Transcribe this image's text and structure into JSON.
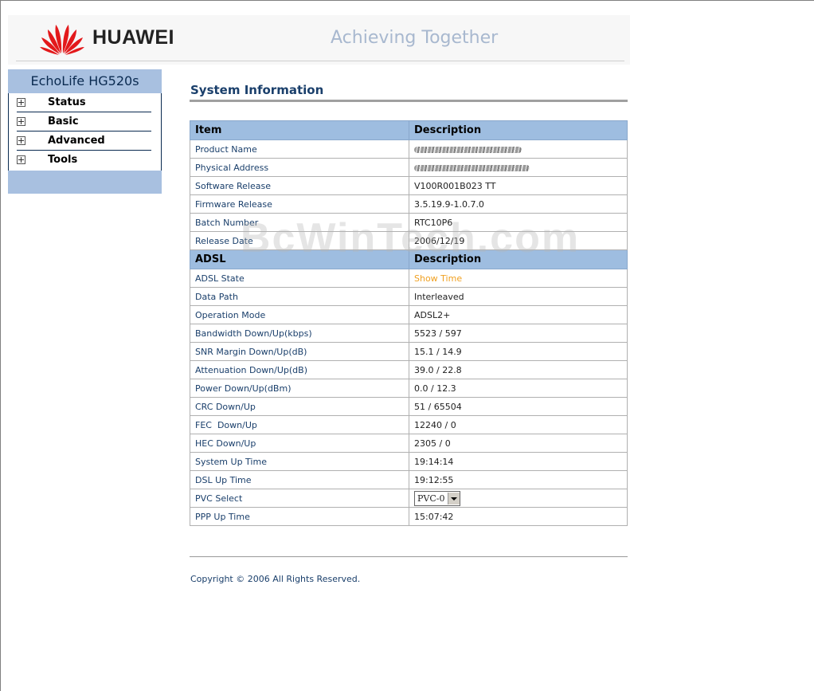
{
  "header": {
    "brand": "HUAWEI",
    "slogan": "Achieving Together",
    "logo_color": "#e3191b"
  },
  "sidebar": {
    "model": "EchoLife HG520s",
    "items": [
      {
        "label": "Status"
      },
      {
        "label": "Basic"
      },
      {
        "label": "Advanced"
      },
      {
        "label": "Tools"
      }
    ]
  },
  "main": {
    "title": "System Information",
    "section1": {
      "col1": "Item",
      "col2": "Description"
    },
    "rows1": [
      {
        "item": "Product Name",
        "desc": ""
      },
      {
        "item": "Physical Address",
        "desc": ""
      },
      {
        "item": "Software Release",
        "desc": "V100R001B023 TT"
      },
      {
        "item": "Firmware Release",
        "desc": "3.5.19.9-1.0.7.0"
      },
      {
        "item": "Batch Number",
        "desc": "RTC10P6"
      },
      {
        "item": "Release Date",
        "desc": "2006/12/19"
      }
    ],
    "section2": {
      "col1": "ADSL",
      "col2": "Description"
    },
    "rows2": [
      {
        "item": "ADSL State",
        "desc": "Show Time"
      },
      {
        "item": "Data Path",
        "desc": "Interleaved"
      },
      {
        "item": "Operation Mode",
        "desc": "ADSL2+"
      },
      {
        "item": "Bandwidth Down/Up(kbps)",
        "desc": "5523 / 597"
      },
      {
        "item": "SNR Margin Down/Up(dB)",
        "desc": "15.1 / 14.9"
      },
      {
        "item": "Attenuation Down/Up(dB)",
        "desc": "39.0 / 22.8"
      },
      {
        "item": "Power Down/Up(dBm)",
        "desc": "0.0 / 12.3"
      },
      {
        "item": "CRC Down/Up",
        "desc": "51 / 65504"
      },
      {
        "item": "FEC  Down/Up",
        "desc": "12240 / 0"
      },
      {
        "item": "HEC Down/Up",
        "desc": "2305 / 0"
      },
      {
        "item": "System Up Time",
        "desc": "19:14:14"
      },
      {
        "item": "DSL Up Time",
        "desc": "19:12:55"
      },
      {
        "item": "PVC Select",
        "desc": "PVC-0"
      },
      {
        "item": "PPP Up Time",
        "desc": "15:07:42"
      }
    ],
    "copyright": "Copyright © 2006 All Rights Reserved."
  },
  "watermark": "BcWinTech.com",
  "colors": {
    "accent": "#9ebde0",
    "title": "#1a3f6b",
    "show_time": "#f0a020"
  }
}
